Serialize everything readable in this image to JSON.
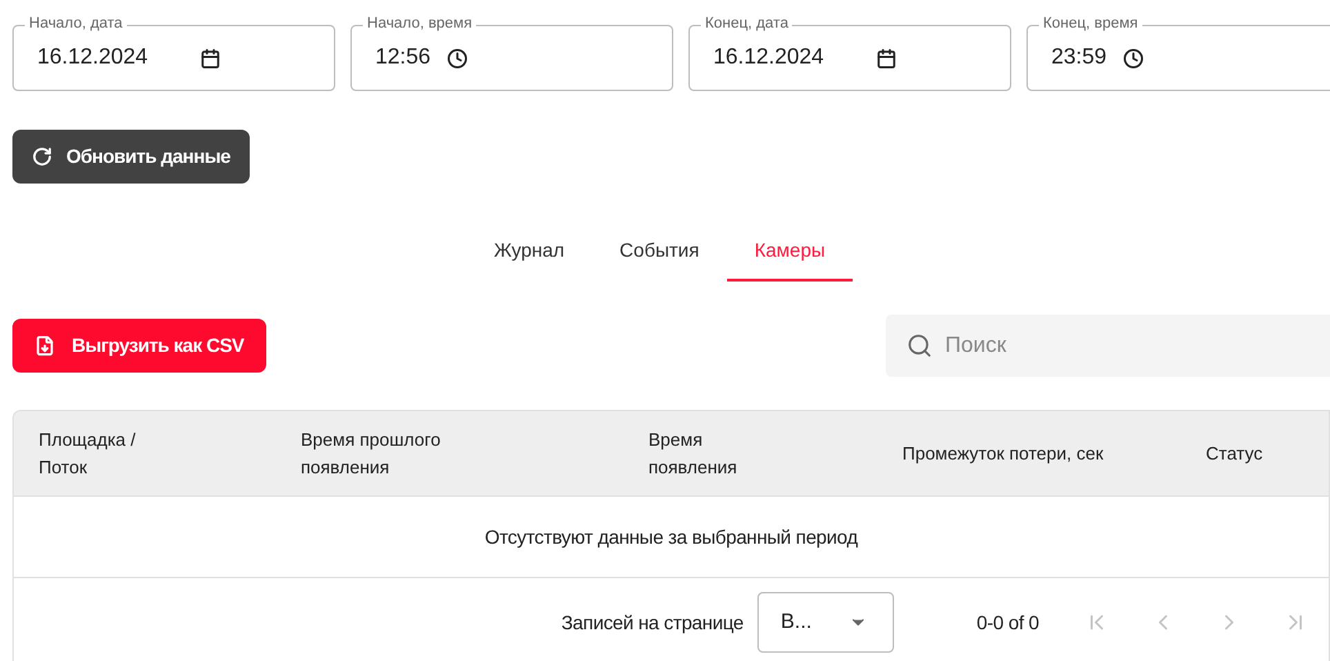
{
  "filters": [
    {
      "label": "Начало, дата",
      "value": "16.12.2024",
      "kind": "date"
    },
    {
      "label": "Начало, время",
      "value": "12:56",
      "kind": "time"
    },
    {
      "label": "Конец, дата",
      "value": "16.12.2024",
      "kind": "date"
    },
    {
      "label": "Конец, время",
      "value": "23:59",
      "kind": "time"
    }
  ],
  "refresh_button": "Обновить данные",
  "tabs": [
    {
      "label": "Журнал",
      "selected": false
    },
    {
      "label": "События",
      "selected": false
    },
    {
      "label": "Камеры",
      "selected": true
    }
  ],
  "export_button": "Выгрузить как CSV",
  "search": {
    "placeholder": "Поиск"
  },
  "table": {
    "columns": [
      "Площадка / Поток",
      "Время прошлого появления",
      "Время появления",
      "Промежуток потери, сек",
      "Статус"
    ],
    "empty_message": "Отсутствуют данные за выбранный период"
  },
  "pagination": {
    "rows_label": "Записей на странице",
    "rows_value": "В...",
    "range": "0-0 of 0",
    "buttons": [
      {
        "kind": "first",
        "disabled": true
      },
      {
        "kind": "prev",
        "disabled": true
      },
      {
        "kind": "next",
        "disabled": true
      },
      {
        "kind": "last",
        "disabled": true
      }
    ]
  }
}
